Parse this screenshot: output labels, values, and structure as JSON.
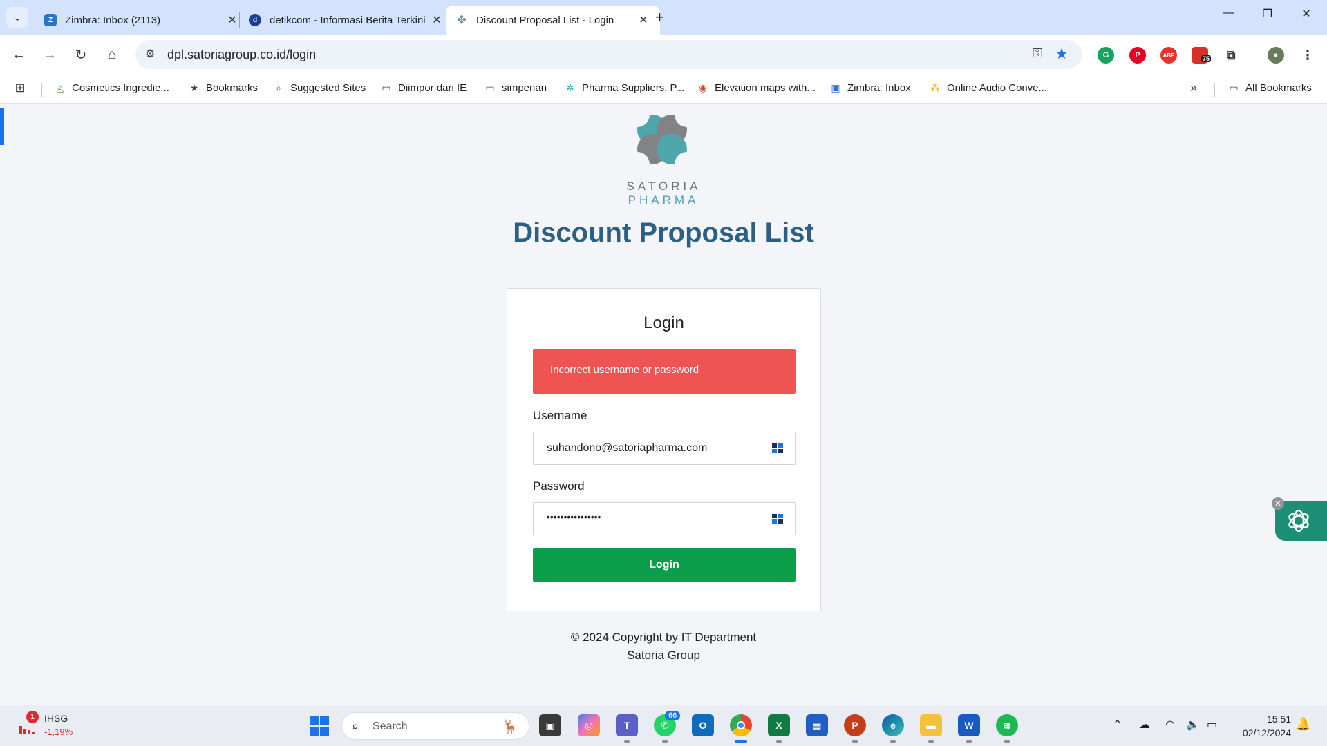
{
  "browser": {
    "tabs": [
      {
        "title": "Zimbra: Inbox (2113)",
        "icon": "zimbra-icon",
        "active": false
      },
      {
        "title": "detikcom - Informasi Berita Terkini",
        "icon": "detik-icon",
        "active": false
      },
      {
        "title": "Discount Proposal List - Login",
        "icon": "puzzle-icon",
        "active": true
      }
    ],
    "url": "dpl.satoriagroup.co.id/login",
    "extension_badge": "75",
    "bookmarks": [
      {
        "label": "Cosmetics Ingredie...",
        "icon": "cosmetics-icon"
      },
      {
        "label": "Bookmarks",
        "icon": "star-icon"
      },
      {
        "label": "Suggested Sites",
        "icon": "search-icon"
      },
      {
        "label": "Diimpor dari IE",
        "icon": "folder-icon"
      },
      {
        "label": "simpenan",
        "icon": "folder-icon"
      },
      {
        "label": "Pharma Suppliers, P...",
        "icon": "pharma-icon"
      },
      {
        "label": "Elevation maps with...",
        "icon": "elevation-icon"
      },
      {
        "label": "Zimbra: Inbox",
        "icon": "zimbra-icon"
      },
      {
        "label": "Online Audio Conve...",
        "icon": "audio-icon"
      }
    ],
    "all_bookmarks": "All Bookmarks"
  },
  "page": {
    "brand": {
      "part1": "SATORIA",
      "part2": "PHARMA"
    },
    "title": "Discount Proposal List",
    "login": {
      "heading": "Login",
      "error": "Incorrect username or password",
      "username_label": "Username",
      "username_value": "suhandono@satoriapharma.com",
      "password_label": "Password",
      "password_masked": "••••••••••••••••",
      "submit_label": "Login"
    },
    "footer": {
      "line1": "© 2024 Copyright by IT Department",
      "line2": "Satoria Group"
    }
  },
  "taskbar": {
    "stock": {
      "name": "IHSG",
      "change": "-1,19%",
      "badge": "1"
    },
    "search_placeholder": "Search",
    "whatsapp_badge": "66",
    "time": "15:51",
    "date": "02/12/2024"
  },
  "colors": {
    "title": "#2c5f86",
    "alert": "#ee5451",
    "button": "#0a9e4a",
    "accent": "#1a73e8"
  }
}
